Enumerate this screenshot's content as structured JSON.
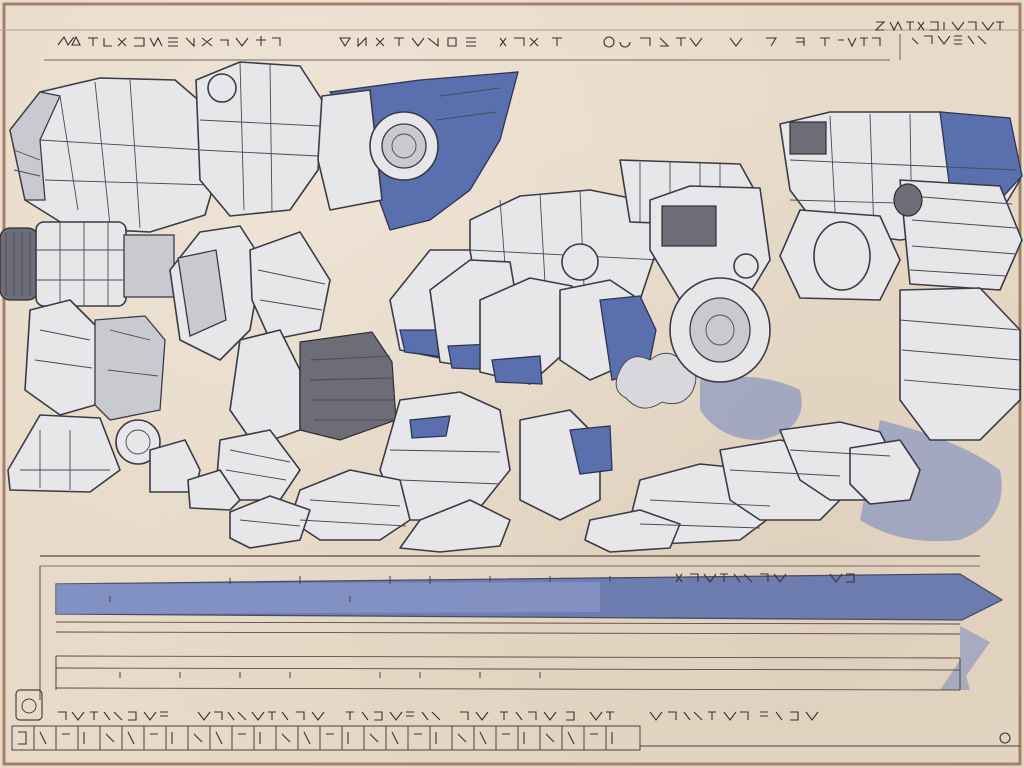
{
  "sheet": {
    "paper_color": "#e8dac8",
    "ink_color": "#3b3b46",
    "accent_blue": "#5a6fae",
    "border_color": "#a77f6a"
  },
  "illustration": {
    "subject": "mech-concept-sketch",
    "icons": [
      "mech-left-icon",
      "mech-center-icon",
      "mech-right-icon",
      "blue-arrow-banner-icon",
      "stamp-icon"
    ]
  }
}
